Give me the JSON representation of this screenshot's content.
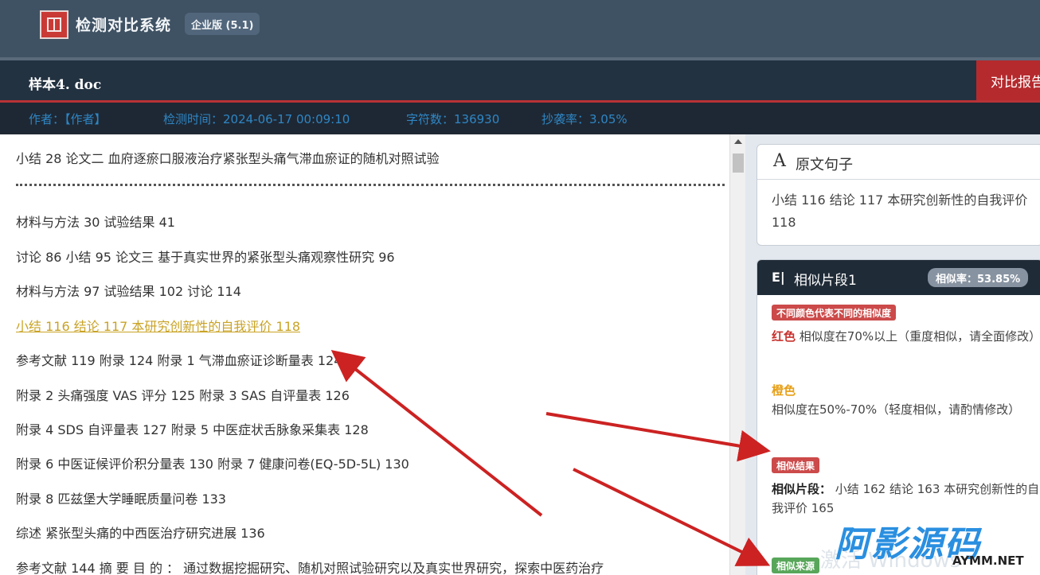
{
  "app": {
    "title": "检测对比系统",
    "edition": "企业版 (5.1)"
  },
  "document": {
    "title": "样本4. doc",
    "report_button": "对比报告"
  },
  "meta": {
    "author": "作者：【作者】",
    "time": "检测时间：2024-06-17 00:09:10",
    "chars": "字符数：136930",
    "rate": "抄袭率：3.05%"
  },
  "content": {
    "lines": [
      "小结 28 论文二 血府逐瘀口服液治疗紧张型头痛气滞血瘀证的随机对照试验",
      "材料与方法 30 试验结果 41",
      "讨论 86 小结 95 论文三 基于真实世界的紧张型头痛观察性研究 96",
      "材料与方法 97 试验结果 102 讨论 114",
      "小结 116 结论 117 本研究创新性的自我评价 118",
      "参考文献 119 附录 124 附录 1 气滞血瘀证诊断量表 124",
      "附录 2 头痛强度 VAS 评分 125 附录 3 SAS 自评量表 126",
      "附录 4 SDS 自评量表 127 附录 5 中医症状舌脉象采集表 128",
      "附录 6 中医证候评价积分量表 130 附录 7 健康问卷(EQ-5D-5L) 130",
      "附录 8 匹兹堡大学睡眠质量问卷 133",
      "综述 紧张型头痛的中西医治疗研究进展 136",
      "参考文献 144 摘 要 目 的 ： 通过数据挖掘研究、随机对照试验研究以及真实世界研究，探索中医药治疗"
    ]
  },
  "original": {
    "icon": "A",
    "title": "原文句子",
    "text": "小结 116 结论 117 本研究创新性的自我评价 118"
  },
  "similar": {
    "icon": "E|",
    "title": "相似片段1",
    "badge": "相似率：53.85%",
    "legend_tag": "不同颜色代表不同的相似度",
    "red_word": "红色",
    "red_text": "相似度在70%以上（重度相似，请全面修改）",
    "orange_word": "橙色",
    "orange_text": "相似度在50%-70%（轻度相似，请酌情修改）",
    "result_tag": "相似结果",
    "fragment_label": "相似片段：",
    "fragment_text": "小结 162 结论 163 本研究创新性的自我评价 165",
    "source_tag": "相似来源"
  },
  "watermark": {
    "text": "激活 Windows",
    "brand": "阿影源码",
    "brand_sub": "AYMM.NET"
  },
  "colors": {
    "accent_red": "#b52a2d",
    "meta_blue": "#2f86c4",
    "highlight": "#c9a326",
    "arrow": "#cc2222"
  }
}
